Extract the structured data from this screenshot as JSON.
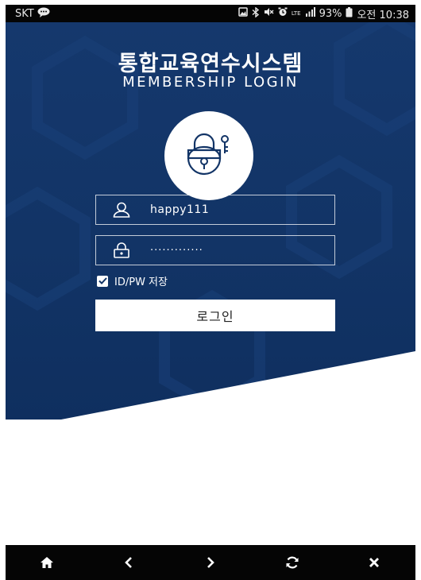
{
  "status_bar": {
    "carrier": "SKT",
    "battery": "93%",
    "time": "오전 10:38",
    "network": "LTE",
    "icons": [
      "chat-bubble-icon",
      "photo-icon",
      "bluetooth-icon",
      "mute-icon",
      "alarm-icon",
      "lte-icon",
      "signal-icon",
      "battery-icon"
    ]
  },
  "login": {
    "title": "통합교육연수시스템",
    "subtitle": "MEMBERSHIP LOGIN",
    "lock_icon": "padlock-key-icon",
    "username_value": "happy111",
    "username_icon": "user-icon",
    "password_value": "·············",
    "password_icon": "lock-icon",
    "save_label": "ID/PW 저장",
    "save_checked": true,
    "login_button": "로그인"
  },
  "bottom_nav": {
    "items": [
      "home-icon",
      "back-icon",
      "forward-icon",
      "refresh-icon",
      "close-icon"
    ]
  },
  "colors": {
    "hero_blue": "#123466",
    "white": "#ffffff",
    "bar_black": "#050505"
  }
}
